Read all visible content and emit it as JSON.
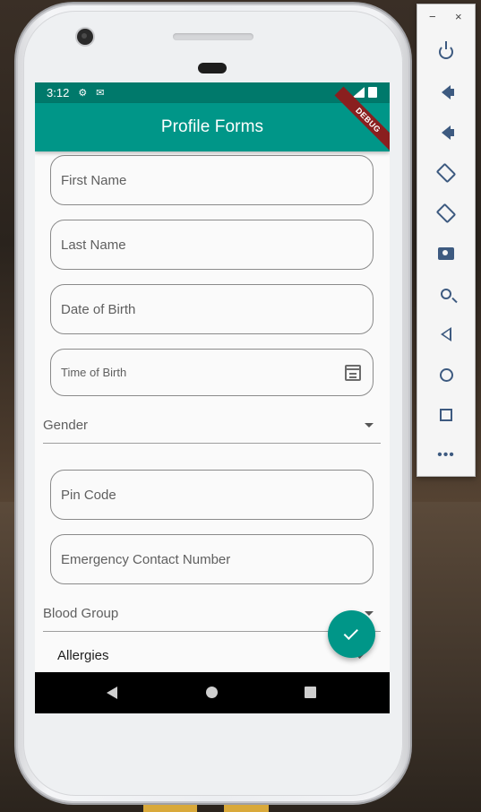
{
  "status_bar": {
    "time": "3:12"
  },
  "app_bar": {
    "title": "Profile Forms",
    "debug_banner": "DEBUG"
  },
  "form": {
    "first_name": {
      "label": "First Name"
    },
    "last_name": {
      "label": "Last Name"
    },
    "date_of_birth": {
      "label": "Date of Birth"
    },
    "time_of_birth": {
      "label": "Time of Birth",
      "icon": "calendar-icon"
    },
    "gender": {
      "label": "Gender"
    },
    "pin_code": {
      "label": "Pin Code"
    },
    "emergency_contact": {
      "label": "Emergency Contact Number"
    },
    "blood_group": {
      "label": "Blood Group"
    },
    "allergies": {
      "label": "Allergies"
    }
  },
  "fab": {
    "icon": "check-icon"
  },
  "nav_bar": {
    "icons": [
      "back-icon",
      "home-icon",
      "recents-icon"
    ]
  },
  "emulator_toolbar": {
    "minimize": "−",
    "close": "×",
    "more": "•••",
    "icons": [
      "power-icon",
      "volume-up-icon",
      "volume-down-icon",
      "rotate-left-icon",
      "rotate-right-icon",
      "camera-icon",
      "zoom-icon",
      "back-icon",
      "home-icon",
      "overview-icon",
      "more-icon"
    ]
  },
  "colors": {
    "primary": "#009688",
    "primary_dark": "#00796b",
    "outline": "#8a8a8a"
  }
}
